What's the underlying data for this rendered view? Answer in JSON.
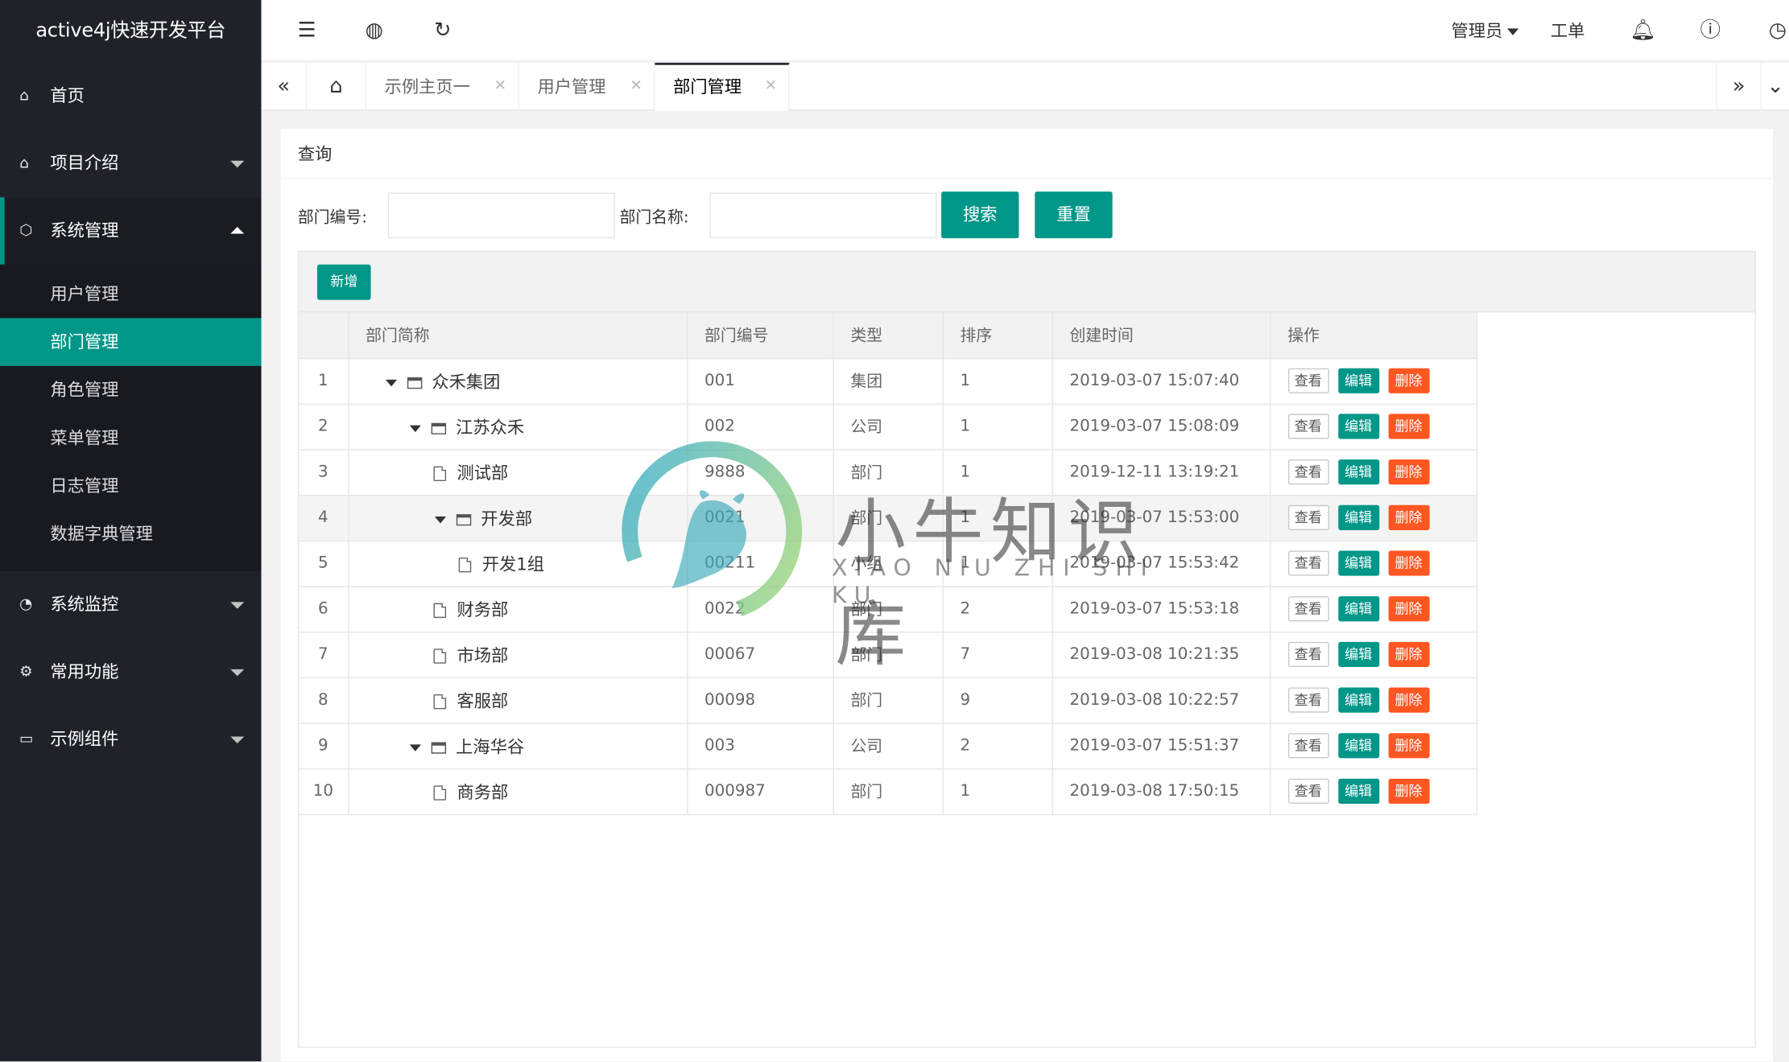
{
  "app": {
    "title": "active4j快速开发平台"
  },
  "sidebar": {
    "items": [
      {
        "label": "首页",
        "icon": "home-icon"
      },
      {
        "label": "项目介绍",
        "icon": "home-icon"
      },
      {
        "label": "系统管理",
        "icon": "cube-icon"
      },
      {
        "label": "系统监控",
        "icon": "dashboard-icon"
      },
      {
        "label": "常用功能",
        "icon": "gear-icon"
      },
      {
        "label": "示例组件",
        "icon": "window-icon"
      }
    ],
    "sub_items": [
      "用户管理",
      "部门管理",
      "角色管理",
      "菜单管理",
      "日志管理",
      "数据字典管理"
    ]
  },
  "topbar": {
    "user": "管理员",
    "ticket": "工单"
  },
  "tabs": [
    {
      "label": "示例主页一"
    },
    {
      "label": "用户管理"
    },
    {
      "label": "部门管理"
    }
  ],
  "panel": {
    "title": "查询",
    "dept_code_label": "部门编号:",
    "dept_name_label": "部门名称:",
    "dept_code_value": "",
    "dept_name_value": "",
    "search_btn": "搜索",
    "reset_btn": "重置",
    "add_btn": "新增"
  },
  "table": {
    "columns": [
      "部门简称",
      "部门编号",
      "类型",
      "排序",
      "创建时间",
      "操作"
    ],
    "actions": {
      "view": "查看",
      "edit": "编辑",
      "delete": "删除"
    },
    "rows": [
      {
        "no": "1",
        "name": "众禾集团",
        "code": "001",
        "type": "集团",
        "sort": "1",
        "time": "2019-03-07 15:07:40",
        "level": 0,
        "kind": "folder"
      },
      {
        "no": "2",
        "name": "江苏众禾",
        "code": "002",
        "type": "公司",
        "sort": "1",
        "time": "2019-03-07 15:08:09",
        "level": 1,
        "kind": "folder"
      },
      {
        "no": "3",
        "name": "测试部",
        "code": "9888",
        "type": "部门",
        "sort": "1",
        "time": "2019-12-11 13:19:21",
        "level": 2,
        "kind": "file"
      },
      {
        "no": "4",
        "name": "开发部",
        "code": "0021",
        "type": "部门",
        "sort": "1",
        "time": "2019-03-07 15:53:00",
        "level": 2,
        "kind": "folder"
      },
      {
        "no": "5",
        "name": "开发1组",
        "code": "00211",
        "type": "小组",
        "sort": "1",
        "time": "2019-03-07 15:53:42",
        "level": 3,
        "kind": "file"
      },
      {
        "no": "6",
        "name": "财务部",
        "code": "0022",
        "type": "部门",
        "sort": "2",
        "time": "2019-03-07 15:53:18",
        "level": 2,
        "kind": "file"
      },
      {
        "no": "7",
        "name": "市场部",
        "code": "00067",
        "type": "部门",
        "sort": "7",
        "time": "2019-03-08 10:21:35",
        "level": 2,
        "kind": "file"
      },
      {
        "no": "8",
        "name": "客服部",
        "code": "00098",
        "type": "部门",
        "sort": "9",
        "time": "2019-03-08 10:22:57",
        "level": 2,
        "kind": "file"
      },
      {
        "no": "9",
        "name": "上海华谷",
        "code": "003",
        "type": "公司",
        "sort": "2",
        "time": "2019-03-07 15:51:37",
        "level": 1,
        "kind": "folder"
      },
      {
        "no": "10",
        "name": "商务部",
        "code": "000987",
        "type": "部门",
        "sort": "1",
        "time": "2019-03-08 17:50:15",
        "level": 2,
        "kind": "file"
      }
    ]
  },
  "watermark": {
    "cn": "小牛知识库",
    "en": "XIAO NIU ZHI SHI KU"
  },
  "colors": {
    "sidebar": "#20222a",
    "accent": "#009688",
    "danger": "#ff5722"
  }
}
